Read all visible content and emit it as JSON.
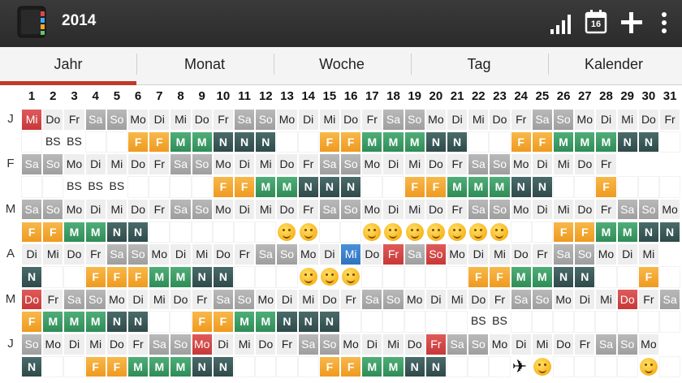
{
  "header": {
    "title": "2014",
    "icons": [
      "app-icon",
      "signal-icon",
      "calendar-icon",
      "add-icon",
      "overflow-menu-icon"
    ],
    "calendar_icon_day": "16"
  },
  "tabs": [
    "Jahr",
    "Monat",
    "Woche",
    "Tag",
    "Kalender"
  ],
  "active_tab": 0,
  "day_numbers": [
    "1",
    "2",
    "3",
    "4",
    "5",
    "6",
    "7",
    "8",
    "9",
    "10",
    "11",
    "12",
    "13",
    "14",
    "15",
    "16",
    "17",
    "18",
    "19",
    "20",
    "21",
    "22",
    "23",
    "24",
    "25",
    "26",
    "27",
    "28",
    "29",
    "30",
    "31"
  ],
  "months": [
    {
      "label": "J",
      "days": [
        "Mi",
        "Do",
        "Fr",
        "Sa",
        "So",
        "Mo",
        "Di",
        "Mi",
        "Do",
        "Fr",
        "Sa",
        "So",
        "Mo",
        "Di",
        "Mi",
        "Do",
        "Fr",
        "Sa",
        "So",
        "Mo",
        "Di",
        "Mi",
        "Do",
        "Fr",
        "Sa",
        "So",
        "Mo",
        "Di",
        "Mi",
        "Do",
        "Fr"
      ],
      "shifts": [
        "",
        "BS",
        "BS",
        "",
        "",
        "F",
        "F",
        "M",
        "M",
        "N",
        "N",
        "N",
        "",
        "",
        "F",
        "F",
        "M",
        "M",
        "M",
        "N",
        "N",
        "",
        "",
        "F",
        "F",
        "M",
        "M",
        "M",
        "N",
        "N",
        ""
      ]
    },
    {
      "label": "F",
      "days": [
        "Sa",
        "So",
        "Mo",
        "Di",
        "Mi",
        "Do",
        "Fr",
        "Sa",
        "So",
        "Mo",
        "Di",
        "Mi",
        "Do",
        "Fr",
        "Sa",
        "So",
        "Mo",
        "Di",
        "Mi",
        "Do",
        "Fr",
        "Sa",
        "So",
        "Mo",
        "Di",
        "Mi",
        "Do",
        "Fr",
        "",
        "",
        ""
      ],
      "shifts": [
        "",
        "",
        "BS",
        "BS",
        "BS",
        "",
        "",
        "",
        "",
        "F",
        "F",
        "M",
        "M",
        "N",
        "N",
        "N",
        "",
        "",
        "F",
        "F",
        "M",
        "M",
        "M",
        "N",
        "N",
        "",
        "",
        "F",
        "",
        "",
        ""
      ]
    },
    {
      "label": "M",
      "days": [
        "Sa",
        "So",
        "Mo",
        "Di",
        "Mi",
        "Do",
        "Fr",
        "Sa",
        "So",
        "Mo",
        "Di",
        "Mi",
        "Do",
        "Fr",
        "Sa",
        "So",
        "Mo",
        "Di",
        "Mi",
        "Do",
        "Fr",
        "Sa",
        "So",
        "Mo",
        "Di",
        "Mi",
        "Do",
        "Fr",
        "Sa",
        "So",
        "Mo"
      ],
      "shifts": [
        "F",
        "F",
        "M",
        "M",
        "N",
        "N",
        "",
        "",
        "",
        "",
        "",
        "",
        "smile",
        "smile",
        "",
        "",
        "smile",
        "smile",
        "smile",
        "smile",
        "smile",
        "smile",
        "smile",
        "",
        "",
        "F",
        "F",
        "M",
        "M",
        "N",
        "N"
      ]
    },
    {
      "label": "A",
      "days": [
        "Di",
        "Mi",
        "Do",
        "Fr",
        "Sa",
        "So",
        "Mo",
        "Di",
        "Mi",
        "Do",
        "Fr",
        "Sa",
        "So",
        "Mo",
        "Di",
        "Mi",
        "Do",
        "Fr",
        "Sa",
        "So",
        "Mo",
        "Di",
        "Mi",
        "Do",
        "Fr",
        "Sa",
        "So",
        "Mo",
        "Di",
        "Mi",
        ""
      ],
      "shifts": [
        "N",
        "",
        "",
        "F",
        "F",
        "F",
        "M",
        "M",
        "N",
        "N",
        "",
        "",
        "",
        "smile",
        "smile",
        "smile",
        "",
        "",
        "",
        "",
        "",
        "F",
        "F",
        "M",
        "M",
        "N",
        "N",
        "",
        "",
        "F",
        ""
      ]
    },
    {
      "label": "M",
      "days": [
        "Do",
        "Fr",
        "Sa",
        "So",
        "Mo",
        "Di",
        "Mi",
        "Do",
        "Fr",
        "Sa",
        "So",
        "Mo",
        "Di",
        "Mi",
        "Do",
        "Fr",
        "Sa",
        "So",
        "Mo",
        "Di",
        "Mi",
        "Do",
        "Fr",
        "Sa",
        "So",
        "Mo",
        "Di",
        "Mi",
        "Do",
        "Fr",
        "Sa"
      ],
      "shifts": [
        "F",
        "M",
        "M",
        "M",
        "N",
        "N",
        "",
        "",
        "F",
        "F",
        "M",
        "M",
        "N",
        "N",
        "N",
        "",
        "",
        "",
        "",
        "",
        "",
        "BS",
        "BS",
        "",
        "",
        "",
        "",
        "",
        "",
        "",
        ""
      ]
    },
    {
      "label": "J",
      "days": [
        "So",
        "Mo",
        "Di",
        "Mi",
        "Do",
        "Fr",
        "Sa",
        "So",
        "Mo",
        "Di",
        "Mi",
        "Do",
        "Fr",
        "Sa",
        "So",
        "Mo",
        "Di",
        "Mi",
        "Do",
        "Fr",
        "Sa",
        "So",
        "Mo",
        "Di",
        "Mi",
        "Do",
        "Fr",
        "Sa",
        "So",
        "Mo",
        ""
      ],
      "shifts": [
        "N",
        "",
        "",
        "F",
        "F",
        "M",
        "M",
        "M",
        "N",
        "N",
        "",
        "",
        "",
        "",
        "F",
        "F",
        "M",
        "M",
        "N",
        "N",
        "",
        "",
        "",
        "plane",
        "smile",
        "",
        "",
        "",
        "",
        "smile",
        ""
      ]
    }
  ],
  "highlights": [
    {
      "month": 0,
      "day": 1,
      "kind": "red"
    },
    {
      "month": 3,
      "day": 16,
      "kind": "blue"
    },
    {
      "month": 3,
      "day": 18,
      "kind": "red"
    },
    {
      "month": 3,
      "day": 20,
      "kind": "red"
    },
    {
      "month": 4,
      "day": 1,
      "kind": "red"
    },
    {
      "month": 4,
      "day": 29,
      "kind": "red"
    },
    {
      "month": 5,
      "day": 9,
      "kind": "red"
    },
    {
      "month": 5,
      "day": 20,
      "kind": "red"
    }
  ],
  "colors": {
    "accent": "#c0392b",
    "early": "#f5a623",
    "middle": "#3b9b66",
    "night": "#3b5a5a",
    "weekend": "#a9a9a9"
  }
}
